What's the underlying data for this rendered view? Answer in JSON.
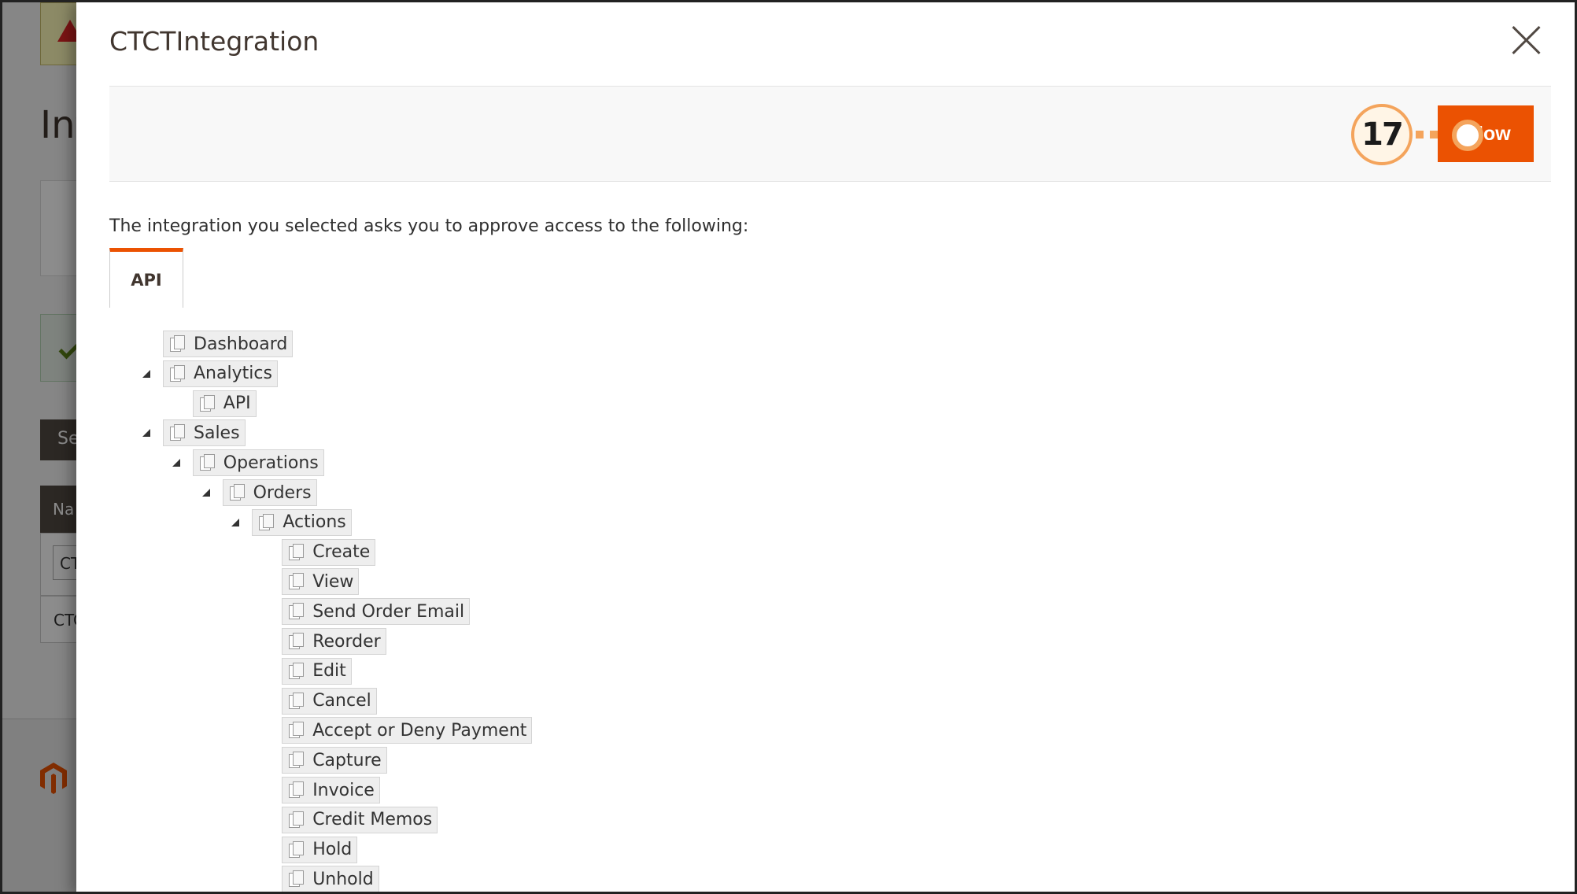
{
  "background": {
    "page_title": "Int",
    "button_label": "Se",
    "table_header": "Na",
    "filter_value": "CT",
    "row_value": "CTC"
  },
  "modal": {
    "title": "CTCTIntegration",
    "allow_label": "Allow",
    "callout_number": "17",
    "intro": "The integration you selected asks you to approve access to the following:",
    "tab_label": "API",
    "accent_color": "#eb5202"
  },
  "tree": [
    {
      "label": "Dashboard",
      "level": 0,
      "expanded": false
    },
    {
      "label": "Analytics",
      "level": 0,
      "expanded": true
    },
    {
      "label": "API",
      "level": 1,
      "expanded": false
    },
    {
      "label": "Sales",
      "level": 0,
      "expanded": true
    },
    {
      "label": "Operations",
      "level": 1,
      "expanded": true
    },
    {
      "label": "Orders",
      "level": 2,
      "expanded": true
    },
    {
      "label": "Actions",
      "level": 3,
      "expanded": true
    },
    {
      "label": "Create",
      "level": 4,
      "expanded": false
    },
    {
      "label": "View",
      "level": 4,
      "expanded": false
    },
    {
      "label": "Send Order Email",
      "level": 4,
      "expanded": false
    },
    {
      "label": "Reorder",
      "level": 4,
      "expanded": false
    },
    {
      "label": "Edit",
      "level": 4,
      "expanded": false
    },
    {
      "label": "Cancel",
      "level": 4,
      "expanded": false
    },
    {
      "label": "Accept or Deny Payment",
      "level": 4,
      "expanded": false
    },
    {
      "label": "Capture",
      "level": 4,
      "expanded": false
    },
    {
      "label": "Invoice",
      "level": 4,
      "expanded": false
    },
    {
      "label": "Credit Memos",
      "level": 4,
      "expanded": false
    },
    {
      "label": "Hold",
      "level": 4,
      "expanded": false
    },
    {
      "label": "Unhold",
      "level": 4,
      "expanded": false
    }
  ]
}
